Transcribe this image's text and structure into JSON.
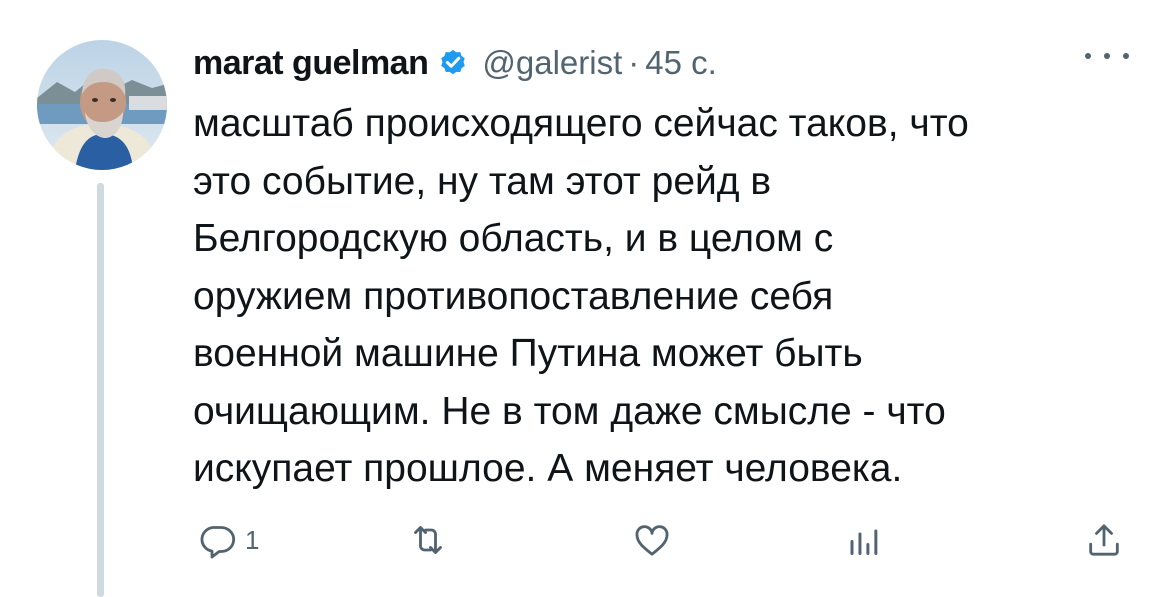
{
  "author": {
    "name": "marat guelman",
    "handle": "@galerist",
    "separator": "·",
    "time": "45 с."
  },
  "tweet": {
    "text": "масштаб происходящего сейчас таков, что\nэто событие, ну там этот рейд в\nБелгородскую область, и в целом с\nоружием противопоставление себя\nвоенной машине Путина может быть\nочищающим. Не в том даже смысле - что\nискупает прошлое. А меняет человека."
  },
  "actions": {
    "reply": {
      "icon": "reply-icon",
      "count": "1"
    },
    "retweet": {
      "icon": "retweet-icon",
      "count": ""
    },
    "like": {
      "icon": "heart-icon",
      "count": ""
    },
    "views": {
      "icon": "views-icon",
      "count": ""
    },
    "share": {
      "icon": "share-icon"
    }
  },
  "colors": {
    "text": "#0f1419",
    "secondary": "#536471",
    "verified": "#1d9bf0",
    "thread_line": "#cfd9de"
  }
}
